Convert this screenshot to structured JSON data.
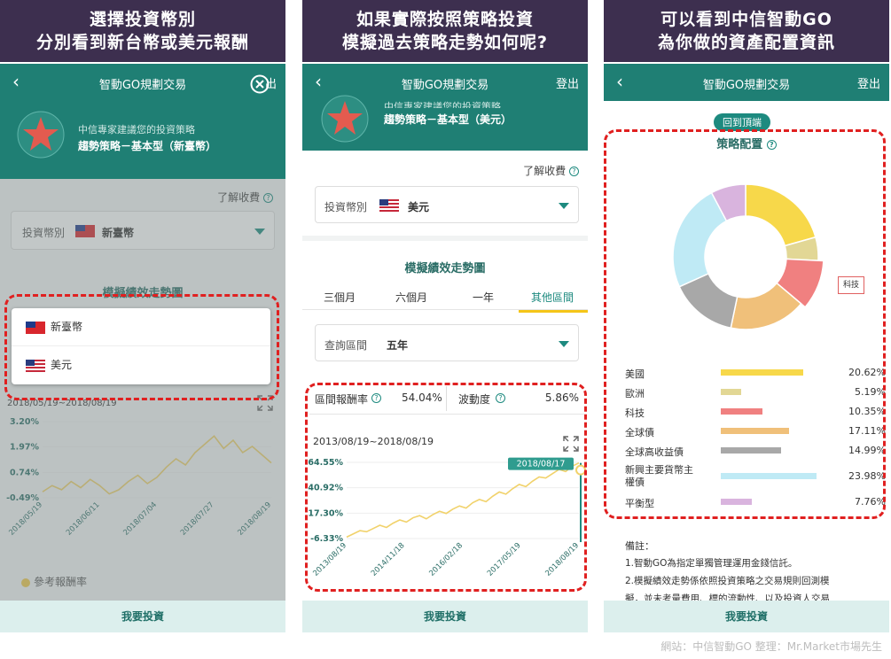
{
  "panel1": {
    "banner": [
      "選擇投資幣別",
      "分別看到新台幣或美元報酬"
    ],
    "appbar_title": "智動GO規劃交易",
    "logout_partial": "出",
    "advisor_text": "中信專家建議您的投資策略",
    "strategy_name": "趨勢策略－基本型（新臺幣）",
    "fee_link": "了解收費",
    "currency_label": "投資幣別",
    "currency_value": "新臺幣",
    "section_title": "模擬績效走勢圖",
    "date_range": "2018/05/19~2018/08/19",
    "options": [
      "新臺幣",
      "美元"
    ],
    "legend": "參考報酬率",
    "invest_button": "我要投資",
    "chart_data": {
      "type": "line",
      "y_ticks": [
        "3.20%",
        "1.97%",
        "0.74%",
        "-0.49%"
      ],
      "x_ticks": [
        "2018/05/19",
        "2018/06/11",
        "2018/07/04",
        "2018/07/27",
        "2018/08/19"
      ],
      "ylim": [
        -0.49,
        3.2
      ],
      "y": [
        -0.2,
        0.1,
        -0.1,
        0.3,
        0.0,
        0.4,
        0.1,
        -0.3,
        -0.1,
        0.3,
        0.6,
        0.2,
        0.5,
        1.0,
        1.4,
        1.1,
        1.7,
        2.1,
        2.5,
        1.9,
        2.3,
        1.7,
        2.0,
        1.6,
        1.2
      ],
      "series": [
        {
          "name": "參考報酬率",
          "color": "#f1d26b"
        }
      ]
    }
  },
  "panel2": {
    "banner": [
      "如果實際按照策略投資",
      "模擬過去策略走勢如何呢?"
    ],
    "appbar_title": "智動GO規劃交易",
    "logout": "登出",
    "advisor_text": "中信專家建議您的投資策略",
    "strategy_name": "趨勢策略－基本型（美元）",
    "fee_link": "了解收費",
    "currency_label": "投資幣別",
    "currency_value": "美元",
    "section_title": "模擬績效走勢圖",
    "tabs": [
      "三個月",
      "六個月",
      "一年",
      "其他區間"
    ],
    "query_label": "查詢區間",
    "query_value": "五年",
    "return_label": "區間報酬率",
    "return_value": "54.04%",
    "volatility_label": "波動度",
    "volatility_value": "5.86%",
    "date_range": "2013/08/19~2018/08/19",
    "tooltip": "2018/08/17",
    "invest_button": "我要投資",
    "chart_data": {
      "type": "line",
      "y_ticks": [
        "64.55%",
        "40.92%",
        "17.30%",
        "-6.33%"
      ],
      "x_ticks": [
        "2013/08/19",
        "2014/11/18",
        "2016/02/18",
        "2017/05/19",
        "2018/08/19"
      ],
      "ylim": [
        -6.33,
        64.55
      ],
      "y": [
        -5,
        -2,
        1,
        0,
        3,
        6,
        4,
        8,
        11,
        9,
        13,
        15,
        12,
        16,
        19,
        17,
        21,
        24,
        22,
        27,
        30,
        28,
        33,
        37,
        35,
        40,
        44,
        42,
        47,
        51,
        50,
        54,
        58,
        56,
        61,
        64
      ],
      "series": [
        {
          "color": "#f1d26b"
        }
      ]
    }
  },
  "panel3": {
    "banner": [
      "可以看到中信智動GO",
      "為你做的資產配置資訊"
    ],
    "appbar_title": "智動GO規劃交易",
    "logout": "登出",
    "back_to_top": "回到頂端",
    "allocation_title": "策略配置",
    "pie_label": "科技",
    "notes_title": "備註：",
    "notes": [
      "1.智動GO為指定單獨管理運用金錢信託。",
      "2.模擬績效走勢係依照投資策略之交易規則回測模",
      "擬，並未考量費用、標的流動性、以及投資人交易"
    ],
    "invest_button": "我要投資",
    "chart_data": {
      "type": "pie",
      "categories": [
        "美國",
        "歐洲",
        "科技",
        "全球債",
        "全球高收益債",
        "新興主要貨幣主權債",
        "平衡型"
      ],
      "values": [
        20.62,
        5.19,
        10.35,
        17.11,
        14.99,
        23.98,
        7.76
      ],
      "labels": [
        "20.62%",
        "5.19%",
        "10.35%",
        "17.11%",
        "14.99%",
        "23.98%",
        "7.76%"
      ],
      "colors": [
        "#f7d84a",
        "#e2d795",
        "#f08080",
        "#f0c07a",
        "#a8a8a8",
        "#bfeaf5",
        "#d9b4de"
      ]
    }
  },
  "credit": "網站：中信智動GO  整理：Mr.Market市場先生"
}
